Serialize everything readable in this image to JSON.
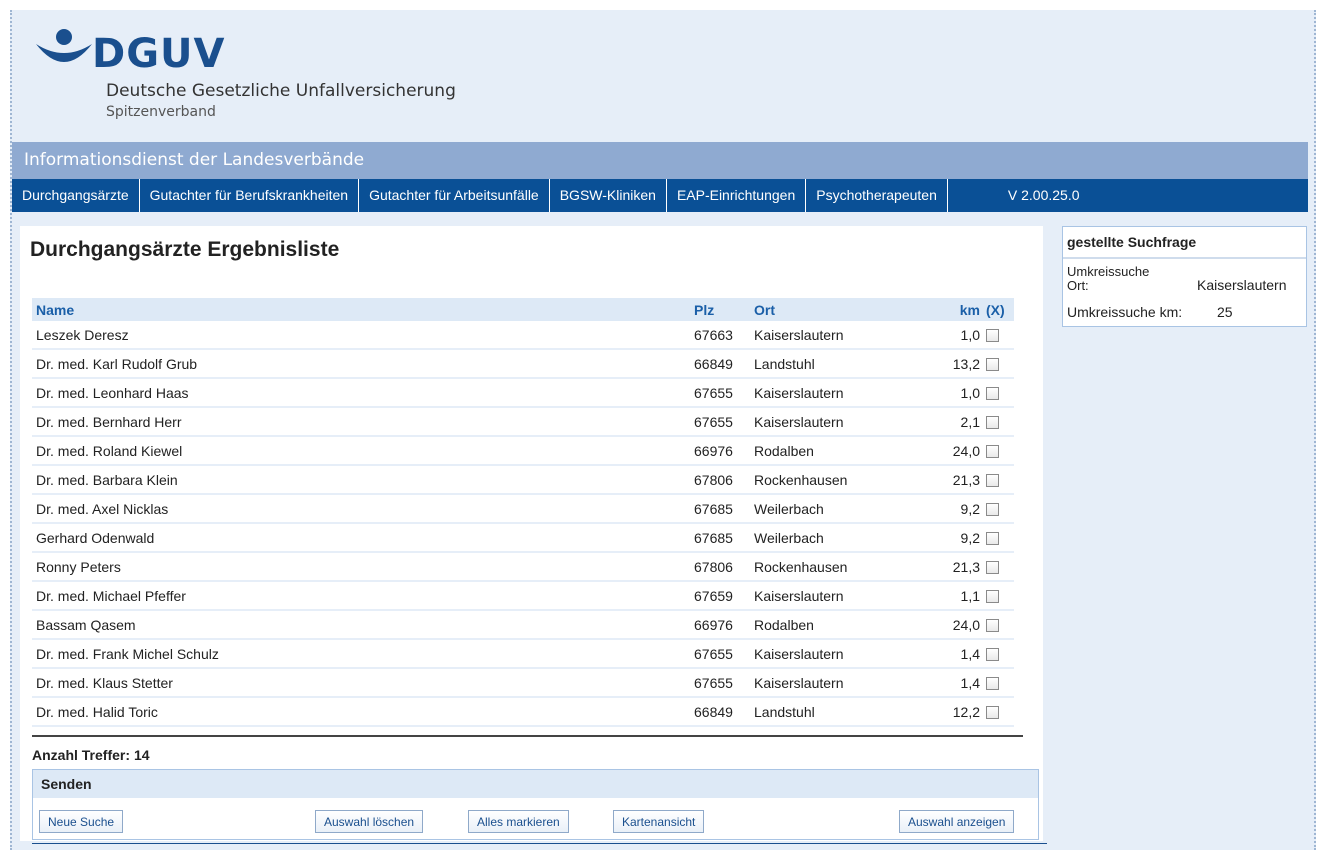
{
  "logo": {
    "wordmark": "DGUV",
    "subtitle": "Deutsche Gesetzliche Unfallversicherung",
    "subtitle2": "Spitzenverband"
  },
  "infobar": {
    "title": "Informationsdienst der Landesverbände"
  },
  "nav": {
    "items": [
      "Durchgangsärzte",
      "Gutachter für Berufskrankheiten",
      "Gutachter für Arbeitsunfälle",
      "BGSW-Kliniken",
      "EAP-Einrichtungen",
      "Psychotherapeuten"
    ],
    "version": "V 2.00.25.0"
  },
  "main": {
    "title": "Durchgangsärzte Ergebnisliste",
    "table": {
      "headers": {
        "name": "Name",
        "plz": "Plz",
        "ort": "Ort",
        "km": "km",
        "x": "(X)"
      },
      "rows": [
        {
          "name": "Leszek Deresz",
          "plz": "67663",
          "ort": "Kaiserslautern",
          "km": "1,0"
        },
        {
          "name": "Dr. med. Karl Rudolf Grub",
          "plz": "66849",
          "ort": "Landstuhl",
          "km": "13,2"
        },
        {
          "name": "Dr. med. Leonhard Haas",
          "plz": "67655",
          "ort": "Kaiserslautern",
          "km": "1,0"
        },
        {
          "name": "Dr. med. Bernhard Herr",
          "plz": "67655",
          "ort": "Kaiserslautern",
          "km": "2,1"
        },
        {
          "name": "Dr. med. Roland Kiewel",
          "plz": "66976",
          "ort": "Rodalben",
          "km": "24,0"
        },
        {
          "name": "Dr. med. Barbara Klein",
          "plz": "67806",
          "ort": "Rockenhausen",
          "km": "21,3"
        },
        {
          "name": "Dr. med. Axel Nicklas",
          "plz": "67685",
          "ort": "Weilerbach",
          "km": "9,2"
        },
        {
          "name": "Gerhard Odenwald",
          "plz": "67685",
          "ort": "Weilerbach",
          "km": "9,2"
        },
        {
          "name": "Ronny Peters",
          "plz": "67806",
          "ort": "Rockenhausen",
          "km": "21,3"
        },
        {
          "name": "Dr. med. Michael Pfeffer",
          "plz": "67659",
          "ort": "Kaiserslautern",
          "km": "1,1"
        },
        {
          "name": "Bassam Qasem",
          "plz": "66976",
          "ort": "Rodalben",
          "km": "24,0"
        },
        {
          "name": "Dr. med. Frank Michel Schulz",
          "plz": "67655",
          "ort": "Kaiserslautern",
          "km": "1,4"
        },
        {
          "name": "Dr. med. Klaus Stetter",
          "plz": "67655",
          "ort": "Kaiserslautern",
          "km": "1,4"
        },
        {
          "name": "Dr. med. Halid Toric",
          "plz": "66849",
          "ort": "Landstuhl",
          "km": "12,2"
        }
      ]
    },
    "hits_label": "Anzahl Treffer:",
    "hits_value": "14",
    "senden": {
      "title": "Senden",
      "buttons": {
        "new_search": "Neue Suche",
        "clear_selection": "Auswahl löschen",
        "mark_all": "Alles markieren",
        "map_view": "Kartenansicht",
        "show_selection": "Auswahl anzeigen"
      }
    }
  },
  "query": {
    "title": "gestellte Suchfrage",
    "ort_label_1": "Umkreissuche",
    "ort_label_2": "Ort:",
    "ort_value": "Kaiserslautern",
    "km_label": "Umkreissuche km:",
    "km_value": "25"
  },
  "colors": {
    "brand": "#1a4f8e",
    "nav_bg": "#0a5096",
    "infobar_bg": "#8faad1",
    "page_bg": "#e6eef8",
    "header_row_bg": "#dde9f6",
    "header_text": "#1a5fa8"
  }
}
